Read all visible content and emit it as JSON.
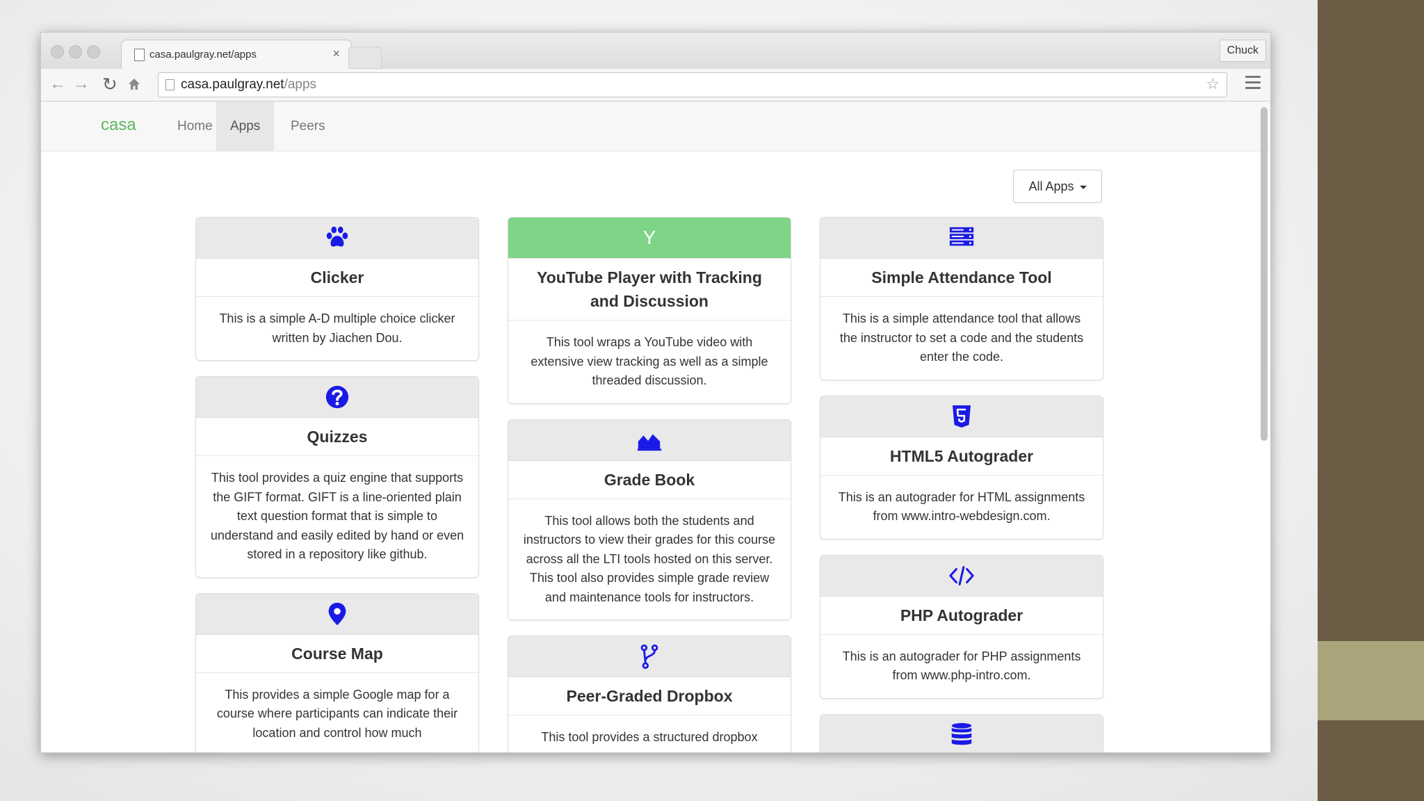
{
  "browser": {
    "tab_title": "casa.paulgray.net/apps",
    "tab_close": "×",
    "profile_name": "Chuck",
    "url_host": "casa.paulgray.net",
    "url_path": "/apps",
    "icons": [
      "back-arrow-icon",
      "forward-arrow-icon",
      "reload-icon",
      "home-icon",
      "bookmark-star-icon",
      "hamburger-menu-icon"
    ]
  },
  "navbar": {
    "brand": "casa",
    "links": [
      "Home",
      "Apps",
      "Peers"
    ],
    "active": "Apps"
  },
  "filter": {
    "label": "All Apps"
  },
  "colors": {
    "icon_blue": "#1a1ae6",
    "brand_green": "#5cb85c",
    "youtube_header": "#7ed487"
  },
  "apps": [
    {
      "icon": "paw-icon",
      "title": "Clicker",
      "description": "This is a simple A-D multiple choice clicker written by Jiachen Dou."
    },
    {
      "icon": "question-circle-icon",
      "title": "Quizzes",
      "description": "This tool provides a quiz engine that supports the GIFT format. GIFT is a line-oriented plain text question format that is simple to understand and easily edited by hand or even stored in a repository like github."
    },
    {
      "icon": "map-marker-icon",
      "title": "Course Map",
      "description": "This provides a simple Google map for a course where participants can indicate their location and control how much"
    },
    {
      "icon": "letter-y-icon",
      "icon_text": "Y",
      "title": "YouTube Player with Tracking and Discussion",
      "description": "This tool wraps a YouTube video with extensive view tracking as well as a simple threaded discussion."
    },
    {
      "icon": "area-chart-icon",
      "title": "Grade Book",
      "description": "This tool allows both the students and instructors to view their grades for this course across all the LTI tools hosted on this server. This tool also provides simple grade review and maintenance tools for instructors."
    },
    {
      "icon": "code-fork-icon",
      "title": "Peer-Graded Dropbox",
      "description": "This tool provides a structured dropbox"
    },
    {
      "icon": "server-icon",
      "title": "Simple Attendance Tool",
      "description": "This is a simple attendance tool that allows the instructor to set a code and the students enter the code."
    },
    {
      "icon": "html5-icon",
      "title": "HTML5 Autograder",
      "description": "This is an autograder for HTML assignments from www.intro-webdesign.com."
    },
    {
      "icon": "code-icon",
      "title": "PHP Autograder",
      "description": "This is an autograder for PHP assignments from www.php-intro.com."
    },
    {
      "icon": "database-icon",
      "title": "",
      "description": ""
    }
  ]
}
